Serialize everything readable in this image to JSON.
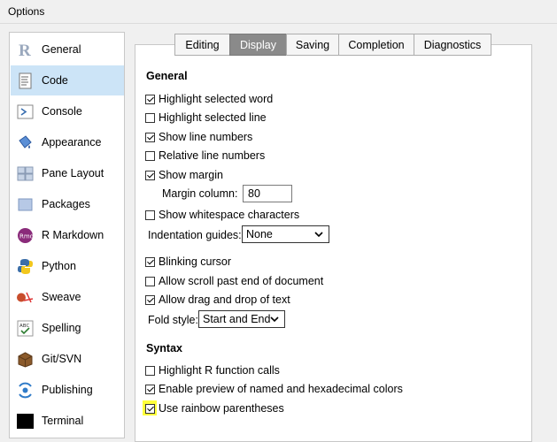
{
  "window": {
    "title": "Options"
  },
  "sidebar": {
    "items": [
      {
        "label": "General",
        "icon": "r-logo-icon"
      },
      {
        "label": "Code",
        "icon": "code-document-icon",
        "selected": true
      },
      {
        "label": "Console",
        "icon": "console-prompt-icon"
      },
      {
        "label": "Appearance",
        "icon": "paint-bucket-icon"
      },
      {
        "label": "Pane Layout",
        "icon": "pane-layout-icon"
      },
      {
        "label": "Packages",
        "icon": "packages-icon"
      },
      {
        "label": "R Markdown",
        "icon": "rmd-icon"
      },
      {
        "label": "Python",
        "icon": "python-logo-icon"
      },
      {
        "label": "Sweave",
        "icon": "sweave-pdf-icon"
      },
      {
        "label": "Spelling",
        "icon": "spellcheck-icon"
      },
      {
        "label": "Git/SVN",
        "icon": "git-box-icon"
      },
      {
        "label": "Publishing",
        "icon": "publishing-icon"
      },
      {
        "label": "Terminal",
        "icon": "terminal-icon"
      }
    ]
  },
  "tabs": [
    {
      "label": "Editing"
    },
    {
      "label": "Display",
      "active": true
    },
    {
      "label": "Saving"
    },
    {
      "label": "Completion"
    },
    {
      "label": "Diagnostics"
    }
  ],
  "general": {
    "title": "General",
    "highlight_selected_word": {
      "label": "Highlight selected word",
      "checked": true
    },
    "highlight_selected_line": {
      "label": "Highlight selected line",
      "checked": false
    },
    "show_line_numbers": {
      "label": "Show line numbers",
      "checked": true
    },
    "relative_line_numbers": {
      "label": "Relative line numbers",
      "checked": false
    },
    "show_margin": {
      "label": "Show margin",
      "checked": true
    },
    "margin_column": {
      "label": "Margin column:",
      "value": "80"
    },
    "show_whitespace": {
      "label": "Show whitespace characters",
      "checked": false
    },
    "indentation_guides": {
      "label": "Indentation guides:",
      "value": "None"
    },
    "blinking_cursor": {
      "label": "Blinking cursor",
      "checked": true
    },
    "allow_scroll_past_end": {
      "label": "Allow scroll past end of document",
      "checked": false
    },
    "allow_drag_drop": {
      "label": "Allow drag and drop of text",
      "checked": true
    },
    "fold_style": {
      "label": "Fold style:",
      "value": "Start and End"
    }
  },
  "syntax": {
    "title": "Syntax",
    "highlight_r_function_calls": {
      "label": "Highlight R function calls",
      "checked": false
    },
    "enable_color_preview": {
      "label": "Enable preview of named and hexadecimal colors",
      "checked": true
    },
    "rainbow_parentheses": {
      "label": "Use rainbow parentheses",
      "checked": true
    }
  },
  "colors": {
    "selected_bg": "#cce4f7",
    "active_tab_bg": "#8a8a8a",
    "annotation_highlight": "#ffff3a"
  }
}
